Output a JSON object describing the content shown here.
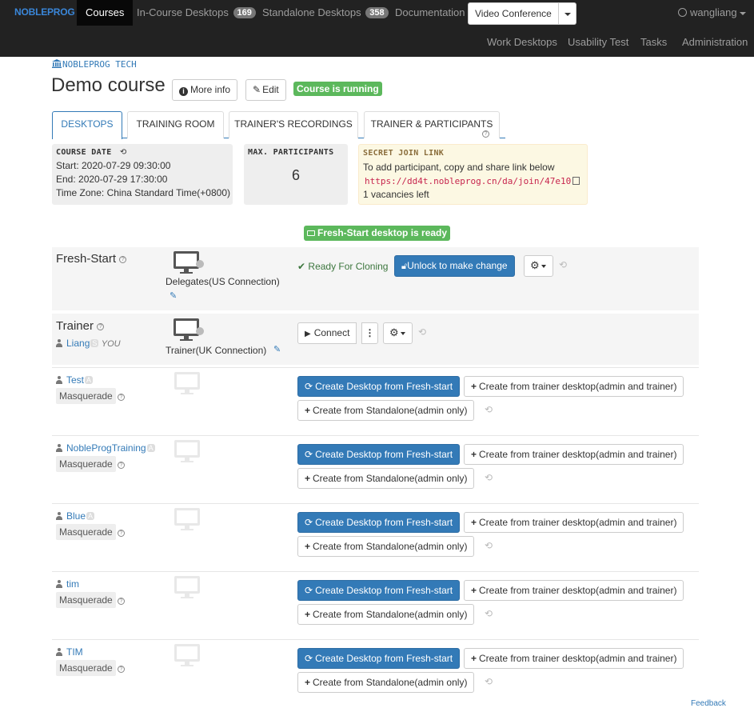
{
  "nav": {
    "brand": "NOBLEPROG",
    "courses": "Courses",
    "in_course": "In-Course Desktops",
    "in_course_count": "169",
    "standalone": "Standalone Desktops",
    "standalone_count": "358",
    "documentation": "Documentation",
    "video_conference": "Video Conference",
    "user": "wangliang",
    "work_desktops": "Work Desktops",
    "usability_test": "Usability Test",
    "tasks": "Tasks",
    "administration": "Administration"
  },
  "header": {
    "org": "NOBLEPROG TECH",
    "title": "Demo course",
    "more_info": "More info",
    "edit": "Edit",
    "status": "Course is running"
  },
  "tabs": [
    "DESKTOPS",
    "TRAINING ROOM",
    "TRAINER'S RECORDINGS",
    "TRAINER & PARTICIPANTS"
  ],
  "course_date": {
    "heading": "COURSE DATE",
    "start": "Start: 2020-07-29 09:30:00",
    "end": "End: 2020-07-29 17:30:00",
    "tz": "Time Zone: China Standard Time(+0800)"
  },
  "max_participants": {
    "heading": "MAX. PARTICIPANTS",
    "value": "6"
  },
  "secret": {
    "heading": "SECRET JOIN LINK",
    "desc": "To add participant, copy and share link below",
    "link": "https://dd4t.nobleprog.cn/da/join/47e10",
    "vacancies": "1 vacancies left"
  },
  "fresh_ready": "Fresh-Start desktop is ready",
  "fresh_start": {
    "title": "Fresh-Start",
    "desktop_label": "Delegates(US Connection)",
    "status": "Ready For Cloning",
    "unlock": "Unlock to make change"
  },
  "trainer": {
    "title": "Trainer",
    "name": "Liang",
    "badge": "S",
    "you": "YOU",
    "desktop_label": "Trainer(UK Connection)",
    "connect": "Connect"
  },
  "actions": {
    "create_fresh": "Create Desktop from Fresh-start",
    "create_trainer": "Create from trainer desktop(admin and trainer)",
    "create_standalone": "Create from Standalone(admin only)",
    "masquerade": "Masquerade"
  },
  "participants": [
    {
      "name": "Test",
      "badge": "A"
    },
    {
      "name": "NobleProgTraining",
      "badge": "A"
    },
    {
      "name": "Blue",
      "badge": "A"
    },
    {
      "name": "tim",
      "badge": ""
    },
    {
      "name": "TIM",
      "badge": ""
    }
  ],
  "feedback": "Feedback"
}
